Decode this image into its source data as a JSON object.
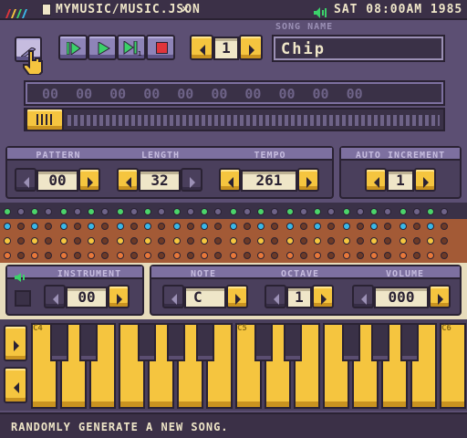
{
  "topbar": {
    "path": "MYMUSIC/MUSIC.JSON",
    "modified_mark": "×",
    "clock": "SAT 08:00AM 1985"
  },
  "transport": {
    "song_number": "1",
    "song_name_label": "SONG NAME",
    "song_name": "Chip",
    "step_cells": [
      "00",
      "00",
      "00",
      "00",
      "00",
      "00",
      "00",
      "00",
      "00",
      "00"
    ]
  },
  "pattern_panel": {
    "pattern_label": "PATTERN",
    "pattern_value": "00",
    "length_label": "LENGTH",
    "length_value": "32",
    "tempo_label": "TEMPO",
    "tempo_value": "261",
    "auto_label": "AUTO INCREMENT",
    "auto_value": "1"
  },
  "instrument_panel": {
    "instrument_label": "INSTRUMENT",
    "instrument_value": "00",
    "note_label": "NOTE",
    "note_value": "C",
    "octave_label": "OCTAVE",
    "octave_value": "1",
    "volume_label": "VOLUME",
    "volume_value": "000"
  },
  "keyboard": {
    "octave_labels": [
      "C4",
      "C5",
      "C6"
    ]
  },
  "status": {
    "message": "RANDOMLY GENERATE A NEW SONG."
  },
  "colors": {
    "background": "#5c4f73",
    "accent_yellow": "#f5c53f",
    "button_purple": "#8e84b8",
    "play_green": "#3bd16a",
    "stop_red": "#e0353b",
    "dot_green": "#4bd36a",
    "dot_blue": "#3ab8e8",
    "dot_yellow": "#f5c53f",
    "dot_orange": "#e8783a"
  }
}
